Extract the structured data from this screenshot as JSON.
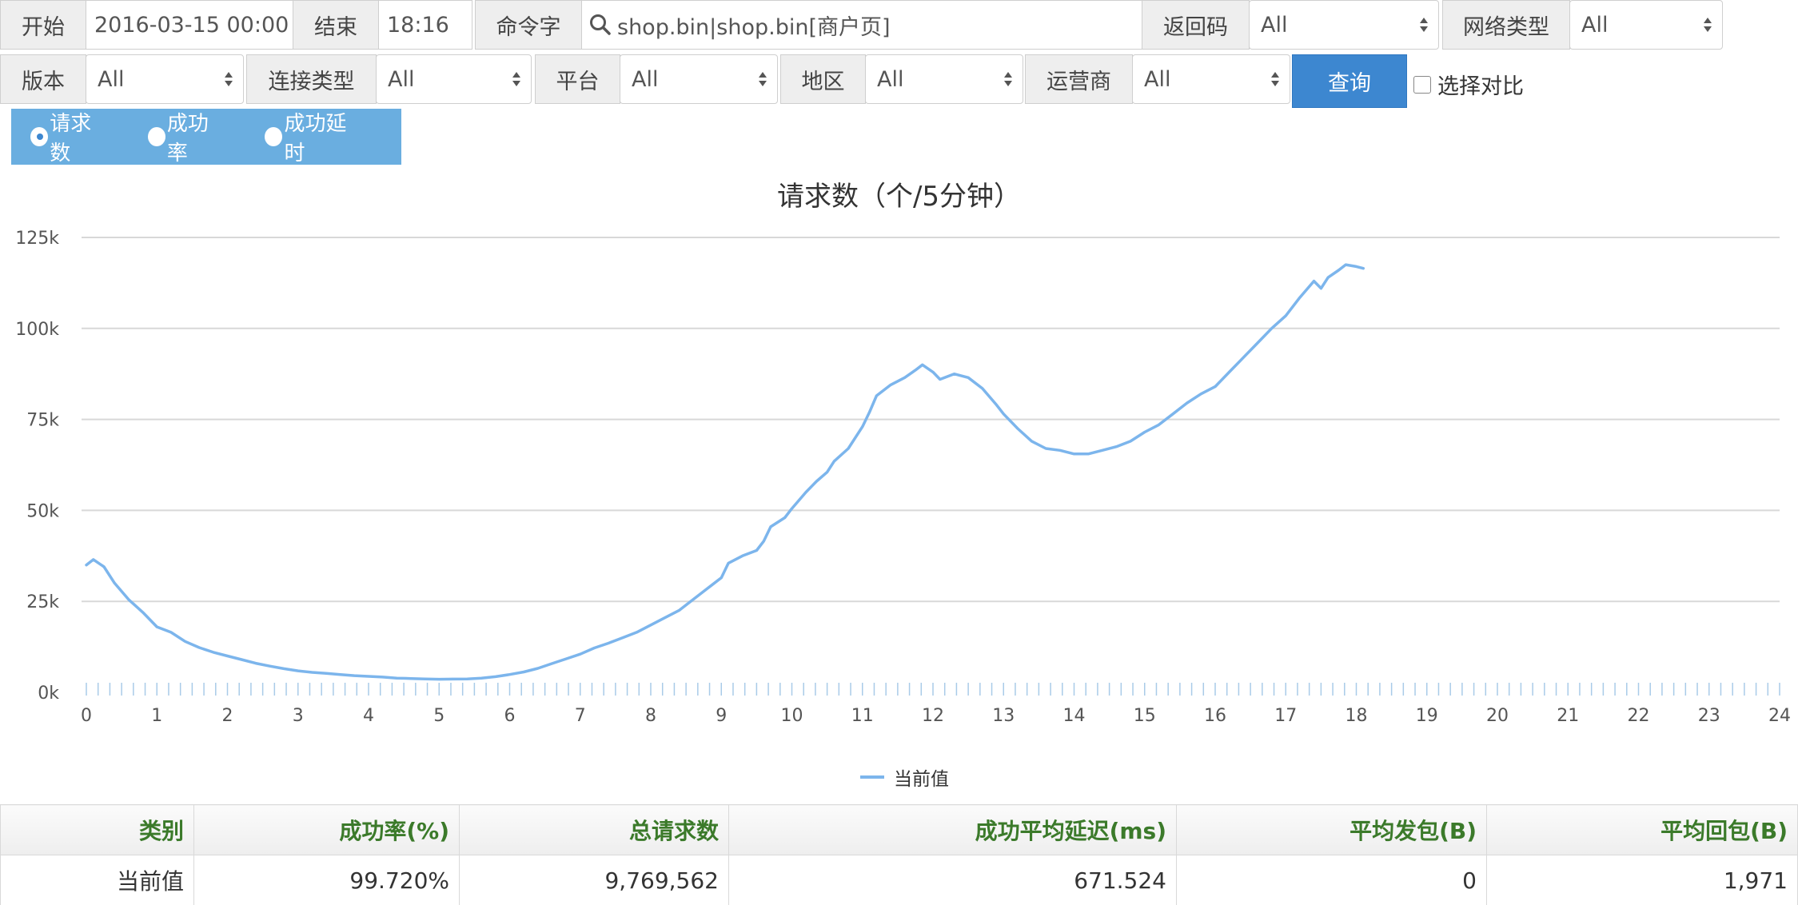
{
  "filters": {
    "start_label": "开始",
    "start_value": "2016-03-15 00:00",
    "end_label": "结束",
    "end_value": "18:16",
    "command_label": "命令字",
    "command_value": "shop.bin|shop.bin[商户页]",
    "return_code_label": "返回码",
    "return_code_value": "All",
    "network_label": "网络类型",
    "network_value": "All",
    "version_label": "版本",
    "version_value": "All",
    "conn_label": "连接类型",
    "conn_value": "All",
    "platform_label": "平台",
    "platform_value": "All",
    "region_label": "地区",
    "region_value": "All",
    "carrier_label": "运营商",
    "carrier_value": "All",
    "query_label": "查询",
    "compare_label": "选择对比"
  },
  "metrics": {
    "selected": "请求数",
    "options": [
      "请求数",
      "成功率",
      "成功延时"
    ]
  },
  "chart_data": {
    "type": "line",
    "title": "请求数（个/5分钟）",
    "xlabel": "",
    "ylabel": "",
    "xlim": [
      0,
      24
    ],
    "ylim": [
      0,
      125000
    ],
    "x_ticks": [
      "0",
      "1",
      "2",
      "3",
      "4",
      "5",
      "6",
      "7",
      "8",
      "9",
      "10",
      "11",
      "12",
      "13",
      "14",
      "15",
      "16",
      "17",
      "18",
      "19",
      "20",
      "21",
      "22",
      "23",
      "24"
    ],
    "y_ticks": [
      "0k",
      "25k",
      "50k",
      "75k",
      "100k",
      "125k"
    ],
    "grid": true,
    "legend": "bottom-center",
    "series": [
      {
        "name": "当前值",
        "color": "#7cb5ec",
        "points": [
          [
            0.0,
            35000
          ],
          [
            0.1,
            36500
          ],
          [
            0.25,
            34500
          ],
          [
            0.4,
            30000
          ],
          [
            0.6,
            25500
          ],
          [
            0.8,
            22000
          ],
          [
            1.0,
            18000
          ],
          [
            1.2,
            16500
          ],
          [
            1.4,
            14000
          ],
          [
            1.6,
            12300
          ],
          [
            1.8,
            11000
          ],
          [
            2.0,
            10000
          ],
          [
            2.2,
            9000
          ],
          [
            2.4,
            8000
          ],
          [
            2.6,
            7200
          ],
          [
            2.8,
            6500
          ],
          [
            3.0,
            5900
          ],
          [
            3.2,
            5500
          ],
          [
            3.4,
            5200
          ],
          [
            3.6,
            4900
          ],
          [
            3.8,
            4600
          ],
          [
            4.0,
            4400
          ],
          [
            4.2,
            4200
          ],
          [
            4.4,
            3900
          ],
          [
            4.6,
            3800
          ],
          [
            4.8,
            3700
          ],
          [
            5.0,
            3600
          ],
          [
            5.2,
            3650
          ],
          [
            5.4,
            3700
          ],
          [
            5.6,
            3900
          ],
          [
            5.8,
            4300
          ],
          [
            6.0,
            4900
          ],
          [
            6.2,
            5600
          ],
          [
            6.4,
            6600
          ],
          [
            6.6,
            7900
          ],
          [
            6.8,
            9200
          ],
          [
            7.0,
            10500
          ],
          [
            7.2,
            12200
          ],
          [
            7.4,
            13500
          ],
          [
            7.6,
            15000
          ],
          [
            7.8,
            16500
          ],
          [
            8.0,
            18500
          ],
          [
            8.2,
            20500
          ],
          [
            8.4,
            22500
          ],
          [
            8.6,
            25500
          ],
          [
            8.8,
            28500
          ],
          [
            9.0,
            31500
          ],
          [
            9.1,
            35500
          ],
          [
            9.3,
            37500
          ],
          [
            9.5,
            39000
          ],
          [
            9.6,
            41500
          ],
          [
            9.7,
            45500
          ],
          [
            9.9,
            48000
          ],
          [
            10.0,
            50500
          ],
          [
            10.2,
            55000
          ],
          [
            10.35,
            58000
          ],
          [
            10.5,
            60500
          ],
          [
            10.6,
            63500
          ],
          [
            10.8,
            67000
          ],
          [
            11.0,
            73000
          ],
          [
            11.1,
            77000
          ],
          [
            11.2,
            81500
          ],
          [
            11.4,
            84500
          ],
          [
            11.6,
            86500
          ],
          [
            11.75,
            88500
          ],
          [
            11.85,
            90000
          ],
          [
            12.0,
            88000
          ],
          [
            12.1,
            86000
          ],
          [
            12.3,
            87500
          ],
          [
            12.5,
            86500
          ],
          [
            12.7,
            83500
          ],
          [
            12.9,
            79000
          ],
          [
            13.0,
            76500
          ],
          [
            13.2,
            72500
          ],
          [
            13.4,
            69000
          ],
          [
            13.6,
            67000
          ],
          [
            13.8,
            66500
          ],
          [
            14.0,
            65500
          ],
          [
            14.2,
            65500
          ],
          [
            14.4,
            66500
          ],
          [
            14.6,
            67500
          ],
          [
            14.8,
            69000
          ],
          [
            15.0,
            71500
          ],
          [
            15.2,
            73500
          ],
          [
            15.4,
            76500
          ],
          [
            15.6,
            79500
          ],
          [
            15.8,
            82000
          ],
          [
            16.0,
            84000
          ],
          [
            16.2,
            88000
          ],
          [
            16.4,
            92000
          ],
          [
            16.6,
            96000
          ],
          [
            16.8,
            100000
          ],
          [
            17.0,
            103500
          ],
          [
            17.2,
            108500
          ],
          [
            17.4,
            113000
          ],
          [
            17.5,
            111000
          ],
          [
            17.6,
            114000
          ],
          [
            17.75,
            116000
          ],
          [
            17.85,
            117500
          ],
          [
            18.0,
            117000
          ],
          [
            18.1,
            116500
          ]
        ]
      }
    ]
  },
  "table": {
    "headers": [
      "类别",
      "成功率(%)",
      "总请求数",
      "成功平均延迟(ms)",
      "平均发包(B)",
      "平均回包(B)"
    ],
    "rows": [
      [
        "当前值",
        "99.720%",
        "9,769,562",
        "671.524",
        "0",
        "1,971"
      ]
    ]
  }
}
